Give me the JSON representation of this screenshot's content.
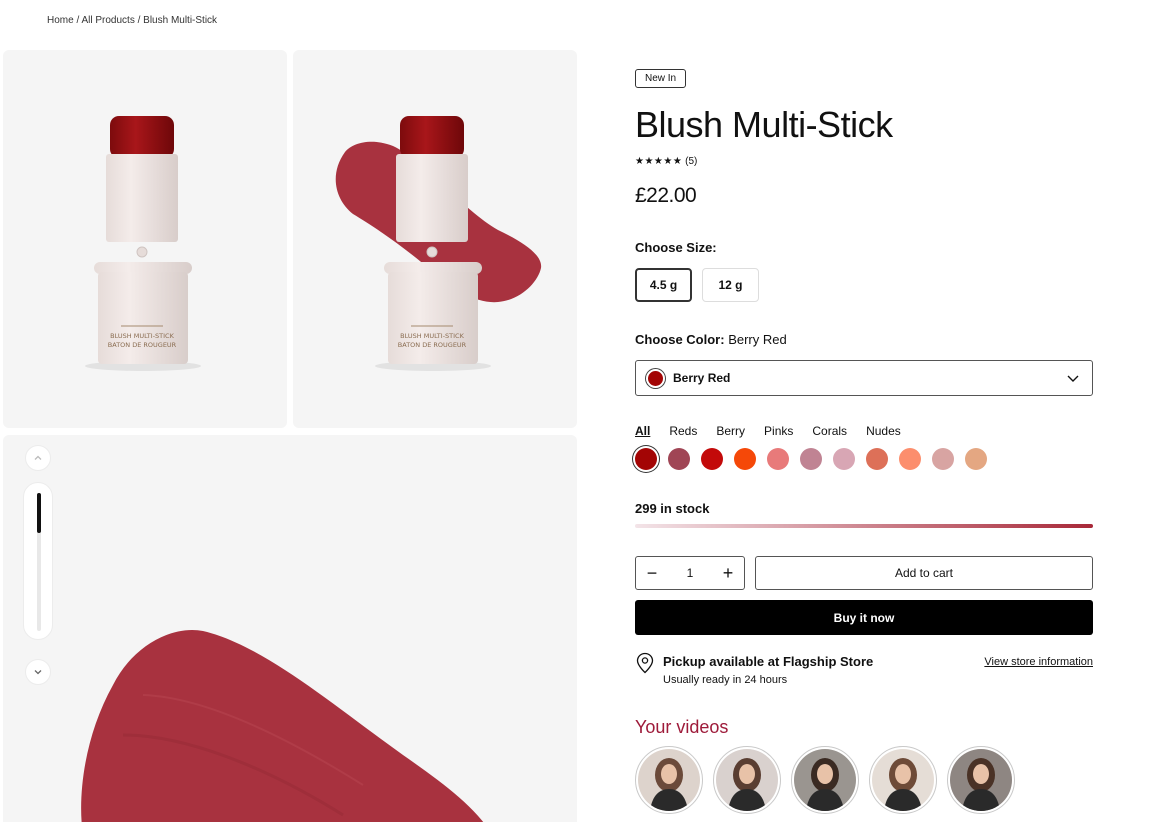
{
  "breadcrumb": "Home / All Products / Blush Multi-Stick",
  "gallery": {
    "stick_label_line1": "BLUSH MULTI-STICK",
    "stick_label_line2": "BATON DE ROUGEUR"
  },
  "product": {
    "badge": "New In",
    "title": "Blush Multi-Stick",
    "stars": "★★★★★",
    "review_count": "(5)",
    "price": "£22.00"
  },
  "size": {
    "label": "Choose Size:",
    "options": [
      "4.5 g",
      "12 g"
    ],
    "selected_index": 0
  },
  "color": {
    "label": "Choose Color:",
    "selected": "Berry Red",
    "dropdown_value": "Berry Red",
    "filters": [
      "All",
      "Reds",
      "Berry",
      "Pinks",
      "Corals",
      "Nudes"
    ],
    "active_filter": "All",
    "swatches": [
      "#a30505",
      "#a04555",
      "#c30a0a",
      "#f54808",
      "#e87a7a",
      "#c08393",
      "#d8a6b4",
      "#dd7058",
      "#fc8e6d",
      "#d8a4a2",
      "#e4a782"
    ]
  },
  "stock": {
    "text": "299 in stock",
    "level": 1.0
  },
  "cart": {
    "quantity": "1",
    "minus": "−",
    "plus": "+",
    "add_to_cart": "Add to cart",
    "buy_now": "Buy it now"
  },
  "pickup": {
    "title": "Pickup available at Flagship Store",
    "subtitle": "Usually ready in 24 hours",
    "link": "View store information"
  },
  "videos": {
    "title": "Your videos",
    "count": 5
  },
  "colors": {
    "accent": "#9e1b3a",
    "swatch_color": "#a8323f",
    "stick_cap": "#9e0f12"
  }
}
